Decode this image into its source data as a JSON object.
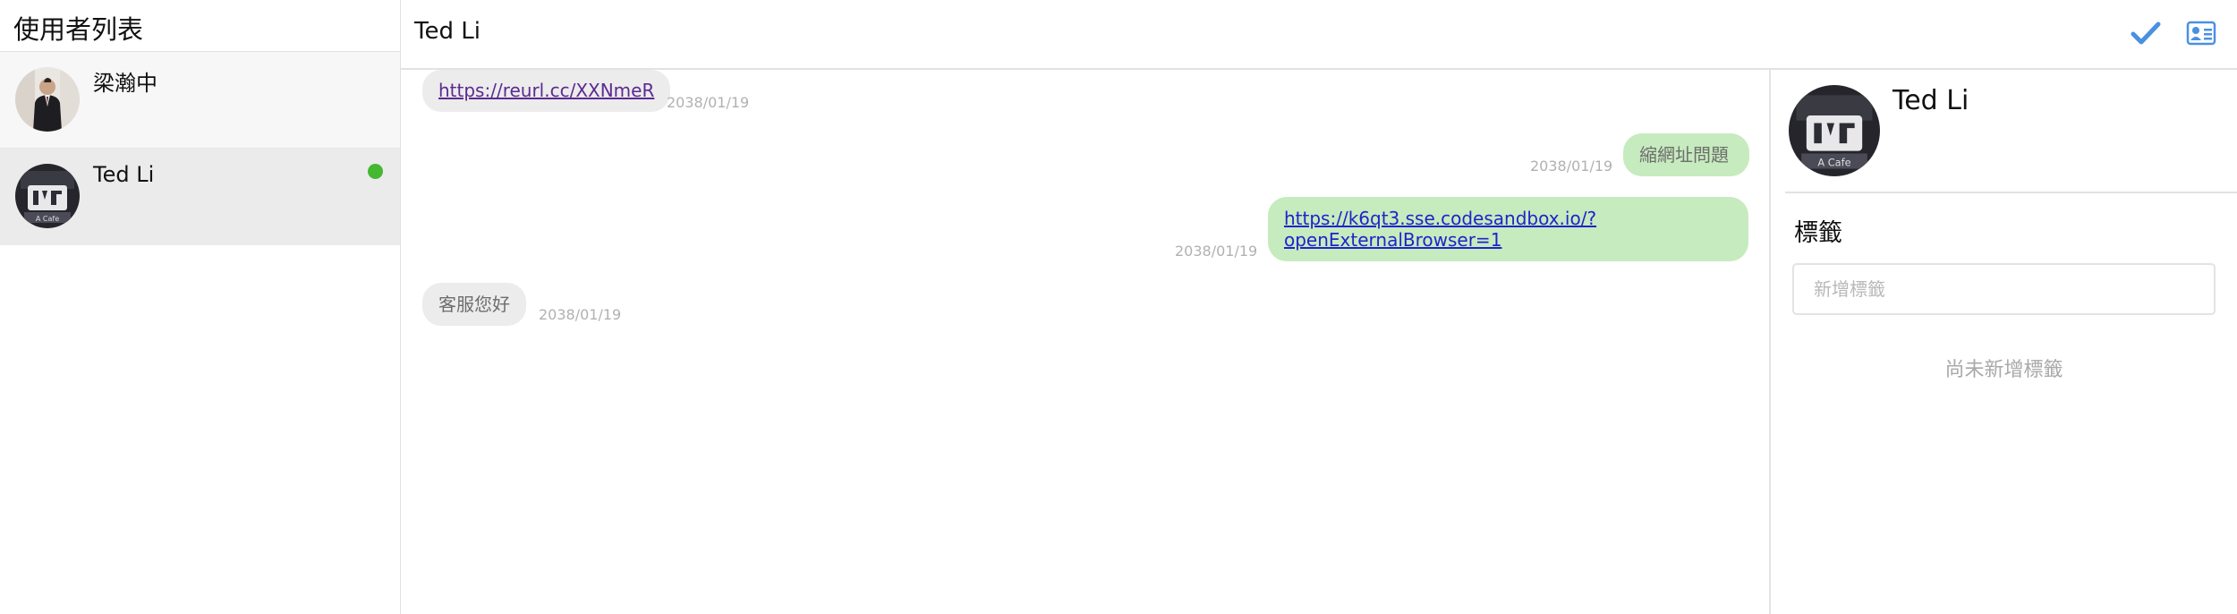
{
  "sidebar": {
    "title": "使用者列表",
    "users": [
      {
        "name": "梁瀚中",
        "online": false,
        "selected": false
      },
      {
        "name": "Ted Li",
        "online": true,
        "selected": true
      }
    ]
  },
  "chat": {
    "title": "Ted Li",
    "icons": [
      "checkmark-icon",
      "contact-card-icon"
    ],
    "messages": [
      {
        "direction": "incoming",
        "type": "link",
        "text": "https://reurl.cc/XXNmeR",
        "time": "2038/01/19"
      },
      {
        "direction": "outgoing",
        "type": "text",
        "text": "縮網址問題",
        "time": "2038/01/19"
      },
      {
        "direction": "outgoing",
        "type": "link",
        "line1": "https://k6qt3.sse.codesandbox.io/?",
        "line2": "openExternalBrowser=1",
        "time": "2038/01/19"
      },
      {
        "direction": "incoming",
        "type": "text",
        "text": "客服您好",
        "time": "2038/01/19"
      }
    ]
  },
  "profile": {
    "name": "Ted Li",
    "tags_heading": "標籤",
    "tag_input_placeholder": "新增標籤",
    "empty_tags_text": "尚未新增標籤"
  },
  "colors": {
    "accent_blue": "#4a90e2",
    "online_green": "#43b830",
    "outgoing_bubble": "#c6ebbe",
    "incoming_bubble": "#ececec"
  }
}
